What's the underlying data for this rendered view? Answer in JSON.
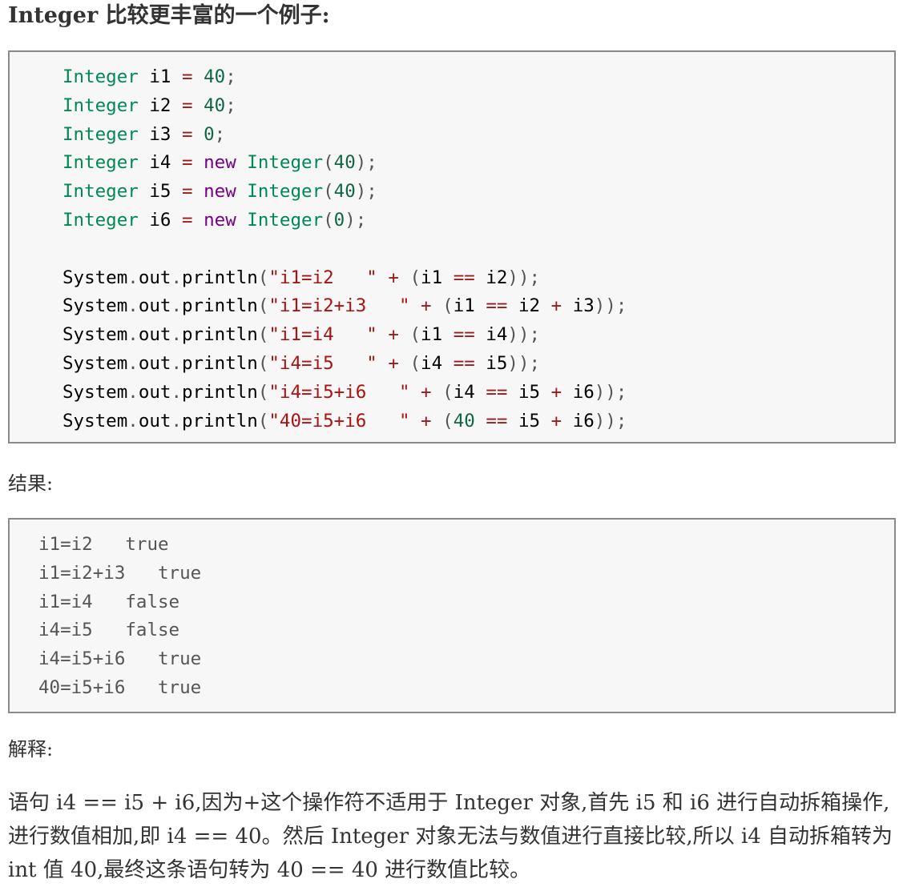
{
  "heading": "Integer 比较更丰富的一个例子:",
  "code": {
    "lines": [
      [
        [
          "type",
          "Integer"
        ],
        [
          "plain",
          " i1 "
        ],
        [
          "op",
          "="
        ],
        [
          "plain",
          " "
        ],
        [
          "num",
          "40"
        ],
        [
          "punc",
          ";"
        ]
      ],
      [
        [
          "type",
          "Integer"
        ],
        [
          "plain",
          " i2 "
        ],
        [
          "op",
          "="
        ],
        [
          "plain",
          " "
        ],
        [
          "num",
          "40"
        ],
        [
          "punc",
          ";"
        ]
      ],
      [
        [
          "type",
          "Integer"
        ],
        [
          "plain",
          " i3 "
        ],
        [
          "op",
          "="
        ],
        [
          "plain",
          " "
        ],
        [
          "num",
          "0"
        ],
        [
          "punc",
          ";"
        ]
      ],
      [
        [
          "type",
          "Integer"
        ],
        [
          "plain",
          " i4 "
        ],
        [
          "op",
          "="
        ],
        [
          "plain",
          " "
        ],
        [
          "kw",
          "new"
        ],
        [
          "plain",
          " "
        ],
        [
          "type",
          "Integer"
        ],
        [
          "punc",
          "("
        ],
        [
          "num",
          "40"
        ],
        [
          "punc",
          ");"
        ]
      ],
      [
        [
          "type",
          "Integer"
        ],
        [
          "plain",
          " i5 "
        ],
        [
          "op",
          "="
        ],
        [
          "plain",
          " "
        ],
        [
          "kw",
          "new"
        ],
        [
          "plain",
          " "
        ],
        [
          "type",
          "Integer"
        ],
        [
          "punc",
          "("
        ],
        [
          "num",
          "40"
        ],
        [
          "punc",
          ");"
        ]
      ],
      [
        [
          "type",
          "Integer"
        ],
        [
          "plain",
          " i6 "
        ],
        [
          "op",
          "="
        ],
        [
          "plain",
          " "
        ],
        [
          "kw",
          "new"
        ],
        [
          "plain",
          " "
        ],
        [
          "type",
          "Integer"
        ],
        [
          "punc",
          "("
        ],
        [
          "num",
          "0"
        ],
        [
          "punc",
          ");"
        ]
      ],
      [],
      [
        [
          "plain",
          "System"
        ],
        [
          "punc",
          "."
        ],
        [
          "plain",
          "out"
        ],
        [
          "punc",
          "."
        ],
        [
          "plain",
          "println"
        ],
        [
          "punc",
          "("
        ],
        [
          "str",
          "\"i1=i2   \""
        ],
        [
          "plain",
          " "
        ],
        [
          "op",
          "+"
        ],
        [
          "plain",
          " "
        ],
        [
          "punc",
          "("
        ],
        [
          "plain",
          "i1 "
        ],
        [
          "op",
          "=="
        ],
        [
          "plain",
          " i2"
        ],
        [
          "punc",
          "));"
        ]
      ],
      [
        [
          "plain",
          "System"
        ],
        [
          "punc",
          "."
        ],
        [
          "plain",
          "out"
        ],
        [
          "punc",
          "."
        ],
        [
          "plain",
          "println"
        ],
        [
          "punc",
          "("
        ],
        [
          "str",
          "\"i1=i2+i3   \""
        ],
        [
          "plain",
          " "
        ],
        [
          "op",
          "+"
        ],
        [
          "plain",
          " "
        ],
        [
          "punc",
          "("
        ],
        [
          "plain",
          "i1 "
        ],
        [
          "op",
          "=="
        ],
        [
          "plain",
          " i2 "
        ],
        [
          "op",
          "+"
        ],
        [
          "plain",
          " i3"
        ],
        [
          "punc",
          "));"
        ]
      ],
      [
        [
          "plain",
          "System"
        ],
        [
          "punc",
          "."
        ],
        [
          "plain",
          "out"
        ],
        [
          "punc",
          "."
        ],
        [
          "plain",
          "println"
        ],
        [
          "punc",
          "("
        ],
        [
          "str",
          "\"i1=i4   \""
        ],
        [
          "plain",
          " "
        ],
        [
          "op",
          "+"
        ],
        [
          "plain",
          " "
        ],
        [
          "punc",
          "("
        ],
        [
          "plain",
          "i1 "
        ],
        [
          "op",
          "=="
        ],
        [
          "plain",
          " i4"
        ],
        [
          "punc",
          "));"
        ]
      ],
      [
        [
          "plain",
          "System"
        ],
        [
          "punc",
          "."
        ],
        [
          "plain",
          "out"
        ],
        [
          "punc",
          "."
        ],
        [
          "plain",
          "println"
        ],
        [
          "punc",
          "("
        ],
        [
          "str",
          "\"i4=i5   \""
        ],
        [
          "plain",
          " "
        ],
        [
          "op",
          "+"
        ],
        [
          "plain",
          " "
        ],
        [
          "punc",
          "("
        ],
        [
          "plain",
          "i4 "
        ],
        [
          "op",
          "=="
        ],
        [
          "plain",
          " i5"
        ],
        [
          "punc",
          "));"
        ]
      ],
      [
        [
          "plain",
          "System"
        ],
        [
          "punc",
          "."
        ],
        [
          "plain",
          "out"
        ],
        [
          "punc",
          "."
        ],
        [
          "plain",
          "println"
        ],
        [
          "punc",
          "("
        ],
        [
          "str",
          "\"i4=i5+i6   \""
        ],
        [
          "plain",
          " "
        ],
        [
          "op",
          "+"
        ],
        [
          "plain",
          " "
        ],
        [
          "punc",
          "("
        ],
        [
          "plain",
          "i4 "
        ],
        [
          "op",
          "=="
        ],
        [
          "plain",
          " i5 "
        ],
        [
          "op",
          "+"
        ],
        [
          "plain",
          " i6"
        ],
        [
          "punc",
          "));"
        ]
      ],
      [
        [
          "plain",
          "System"
        ],
        [
          "punc",
          "."
        ],
        [
          "plain",
          "out"
        ],
        [
          "punc",
          "."
        ],
        [
          "plain",
          "println"
        ],
        [
          "punc",
          "("
        ],
        [
          "str",
          "\"40=i5+i6   \""
        ],
        [
          "plain",
          " "
        ],
        [
          "op",
          "+"
        ],
        [
          "plain",
          " "
        ],
        [
          "punc",
          "("
        ],
        [
          "num",
          "40"
        ],
        [
          "plain",
          " "
        ],
        [
          "op",
          "=="
        ],
        [
          "plain",
          " i5 "
        ],
        [
          "op",
          "+"
        ],
        [
          "plain",
          " i6"
        ],
        [
          "punc",
          "));"
        ]
      ]
    ]
  },
  "result_label": "结果:",
  "output": {
    "lines": [
      "i1=i2   true",
      "i1=i2+i3   true",
      "i1=i4   false",
      "i4=i5   false",
      "i4=i5+i6   true",
      "40=i5+i6   true"
    ]
  },
  "explain_label": "解释:",
  "explanation": "语句 i4 == i5 + i6,因为+这个操作符不适用于 Integer 对象,首先 i5 和 i6 进行自动拆箱操作,进行数值相加,即 i4 == 40。然后 Integer 对象无法与数值进行直接比较,所以 i4 自动拆箱转为 int 值 40,最终这条语句转为 40 == 40 进行数值比较。"
}
